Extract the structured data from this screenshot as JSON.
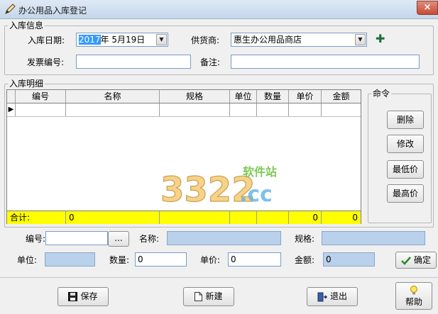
{
  "window": {
    "title": "办公用品入库登记",
    "close_glyph": "×"
  },
  "header_group": {
    "legend": "入库信息",
    "date_label": "入库日期:",
    "date_year": "2017",
    "date_rest": "年  5月19日",
    "supplier_label": "供货商:",
    "supplier_value": "惠生办公用品商店",
    "invoice_label": "发票编号:",
    "invoice_value": "",
    "note_label": "备注:",
    "note_value": ""
  },
  "detail_group": {
    "legend": "入库明细",
    "columns": [
      "编号",
      "名称",
      "规格",
      "单位",
      "数量",
      "单价",
      "金额"
    ],
    "rows": [
      {
        "indicator": "▶",
        "cells": [
          "",
          "",
          "",
          "",
          "",
          "",
          ""
        ]
      }
    ],
    "total_row": {
      "label": "合计:",
      "code": "0",
      "name": "",
      "spec": "",
      "unit": "",
      "qty": "",
      "price": "0",
      "amount": "0"
    }
  },
  "commands": {
    "legend": "命令",
    "buttons": [
      "删除",
      "修改",
      "最低价",
      "最高价"
    ]
  },
  "entry": {
    "code_label": "编号:",
    "code_value": "",
    "browse_label": "...",
    "name_label": "名称:",
    "name_value": "",
    "spec_label": "规格:",
    "spec_value": "",
    "unit_label": "单位:",
    "unit_value": "",
    "qty_label": "数量:",
    "qty_value": "0",
    "price_label": "单价:",
    "price_value": "0",
    "amount_label": "金额:",
    "amount_value": "0",
    "confirm_label": "确定"
  },
  "footer": {
    "save_label": "保存",
    "new_label": "新建",
    "exit_label": "退出",
    "help_label": "帮助"
  },
  "watermark": {
    "digits": "3322",
    "suffix": ".cc",
    "tag": "软件站"
  },
  "colors": {
    "total_row": "#ffff00",
    "readonly_field": "#b9d1ea",
    "selection": "#3399ff",
    "confirm_check": "#2e8b2e",
    "plus_icon": "#1f6e3c"
  }
}
